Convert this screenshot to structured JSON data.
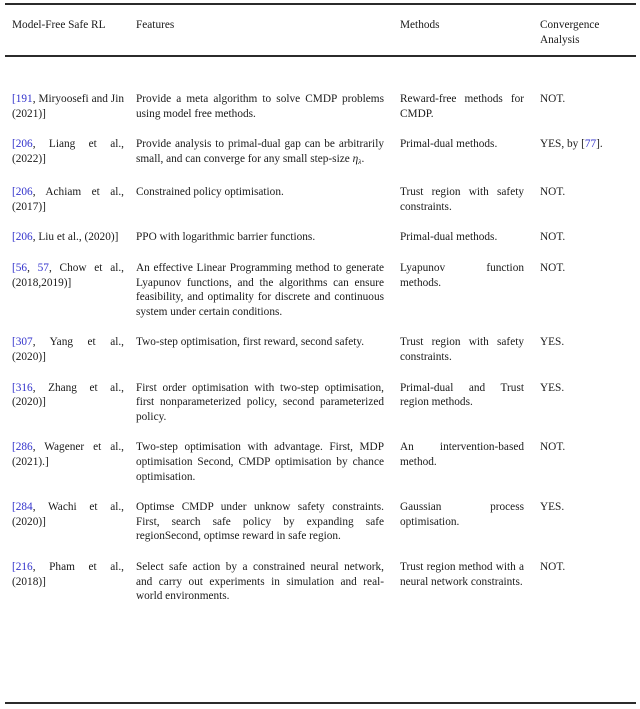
{
  "table": {
    "style": "booktabs",
    "citation_color": "#3333cc",
    "text_color": "#1a1a1a",
    "rule_color": "#2b2b2b",
    "headers": [
      "Model-Free Safe RL",
      "Features",
      "Methods",
      "Convergence Analysis"
    ],
    "rows": [
      {
        "reference": "[191, Miryoosefi and Jin (2021)]",
        "citations": [
          "191"
        ],
        "features": "Provide a meta algorithm to solve CMDP problems using model free methods.",
        "methods": "Reward-free methods for CMDP.",
        "convergence": "NOT."
      },
      {
        "reference": "[206, Liang et al., (2022)]",
        "citations": [
          "206"
        ],
        "features": "Provide analysis to primal-dual gap can be arbitrarily small, and can converge for any small step-size ηλ.",
        "methods": "Primal-dual methods.",
        "convergence": "YES, by [77]."
      },
      {
        "reference": "[206, Achiam et al., (2017)]",
        "citations": [
          "206"
        ],
        "features": "Constrained policy optimisation.",
        "methods": "Trust region with safety constraints.",
        "convergence": "NOT."
      },
      {
        "reference": "[206, Liu et al., (2020)]",
        "citations": [
          "206"
        ],
        "features": "PPO with logarithmic barrier functions.",
        "methods": "Primal-dual methods.",
        "convergence": "NOT."
      },
      {
        "reference": "[56, 57, Chow et al., (2018,2019)]",
        "citations": [
          "56",
          "57"
        ],
        "features": "An effective Linear Programming method to generate Lyapunov functions, and the algorithms can ensure feasibility, and optimality for discrete and continuous system under certain conditions.",
        "methods": "Lyapunov function methods.",
        "convergence": "NOT."
      },
      {
        "reference": "[307, Yang et al., (2020)]",
        "citations": [
          "307"
        ],
        "features": "Two-step optimisation, first reward, second safety.",
        "methods": "Trust region with safety constraints.",
        "convergence": "YES."
      },
      {
        "reference": "[316, Zhang et al.,(2020)]",
        "citations": [
          "316"
        ],
        "features": "First order optimisation with two-step optimisation, first nonparameterized policy, second parameterized policy.",
        "methods": "Primal-dual and Trust region methods.",
        "convergence": "YES."
      },
      {
        "reference": "[286, Wagener et al., (2021).]",
        "citations": [
          "286"
        ],
        "features": "Two-step optimisation with advantage. First, MDP optimisation Second, CMDP optimisation by chance optimisation.",
        "methods": "An intervention-based method.",
        "convergence": "NOT."
      },
      {
        "reference": "[284, Wachi et al.,(2020)]",
        "citations": [
          "284"
        ],
        "features": "Optimse CMDP under unknow safety constraints. First, search safe policy by expanding safe regionSecond, optimse reward in safe region.",
        "methods": "Gaussian process optimisation.",
        "convergence": "YES."
      },
      {
        "reference": "[216, Pham et al., (2018)]",
        "citations": [
          "216"
        ],
        "features": "Select safe action by a constrained neural network, and carry out experiments in simulation and real-world environments.",
        "methods": "Trust region method with a neural network constraints.",
        "convergence": "NOT."
      }
    ]
  }
}
